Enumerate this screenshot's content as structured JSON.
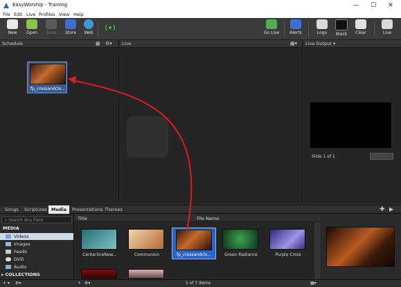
{
  "window": {
    "title": "EasyWorship - Training",
    "controls": [
      "—",
      "☐",
      "✕"
    ]
  },
  "menu": [
    "File",
    "Edit",
    "Live",
    "Profiles",
    "View",
    "Help"
  ],
  "toolbar": {
    "new": "New",
    "open": "Open",
    "save": "Save",
    "store": "Store",
    "web": "Web",
    "golive": "Go Live",
    "alerts": "Alerts",
    "logo": "Logo",
    "black": "Black",
    "clear": "Clear",
    "live": "Live"
  },
  "panels": {
    "schedule": "Schedule",
    "live": "Live",
    "live_output": "Live Output ▾",
    "slide_counter": "Slide 1 of 1"
  },
  "schedule_item": {
    "label": "fp_crossandclo..."
  },
  "tabs": [
    "Songs",
    "Scriptures",
    "Media",
    "Presentations",
    "Themes"
  ],
  "active_tab": "Media",
  "search": {
    "placeholder": "Search Any Field"
  },
  "library": {
    "heading": "MEDIA",
    "items": [
      "Videos",
      "Images",
      "Feeds",
      "DVD",
      "Audio"
    ],
    "collections": "COLLECTIONS"
  },
  "columns": {
    "title": "Title",
    "filename": "File Name"
  },
  "media_items": [
    {
      "label": "CenterlineNew...",
      "color": "#4fa3a8"
    },
    {
      "label": "Communion",
      "color": "#c98a52"
    },
    {
      "label": "fp_crossandclo...",
      "color": "#a4532a"
    },
    {
      "label": "Green Radiance",
      "color": "#2e7a3c"
    },
    {
      "label": "Purple Cross",
      "color": "#6b5fbf"
    }
  ],
  "footer": {
    "count": "1 of 7 items"
  },
  "colors": {
    "accent": "#2a64c7",
    "arrow": "#e01c1c"
  }
}
